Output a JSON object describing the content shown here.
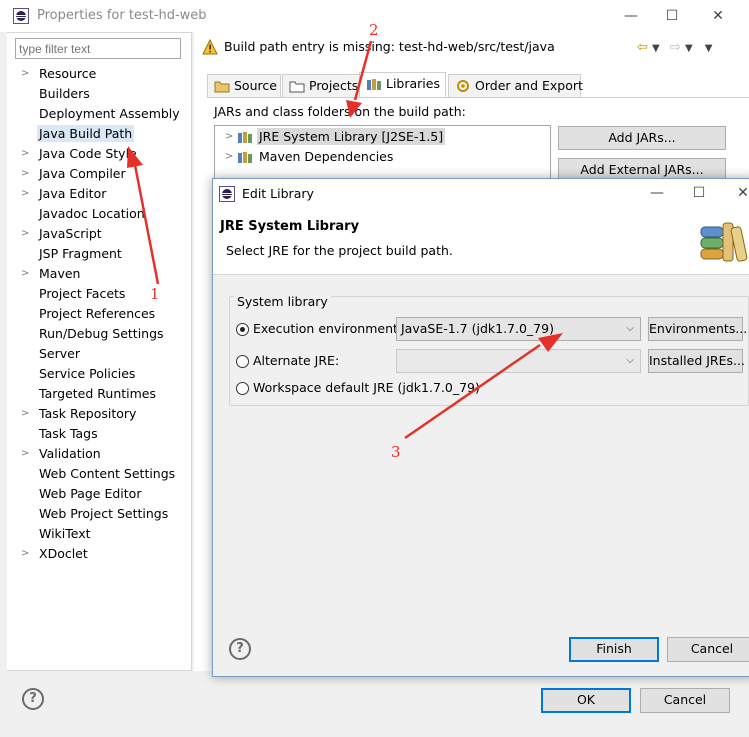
{
  "window": {
    "title": "Properties for test-hd-web",
    "minimize": "—",
    "maximize": "☐",
    "close": "✕"
  },
  "filter": {
    "placeholder": "type filter text"
  },
  "tree": [
    {
      "label": "Resource",
      "expandable": true
    },
    {
      "label": "Builders",
      "expandable": false
    },
    {
      "label": "Deployment Assembly",
      "expandable": false
    },
    {
      "label": "Java Build Path",
      "expandable": false,
      "selected": true
    },
    {
      "label": "Java Code Style",
      "expandable": true
    },
    {
      "label": "Java Compiler",
      "expandable": true
    },
    {
      "label": "Java Editor",
      "expandable": true
    },
    {
      "label": "Javadoc Location",
      "expandable": false
    },
    {
      "label": "JavaScript",
      "expandable": true
    },
    {
      "label": "JSP Fragment",
      "expandable": false
    },
    {
      "label": "Maven",
      "expandable": true
    },
    {
      "label": "Project Facets",
      "expandable": false
    },
    {
      "label": "Project References",
      "expandable": false
    },
    {
      "label": "Run/Debug Settings",
      "expandable": false
    },
    {
      "label": "Server",
      "expandable": false
    },
    {
      "label": "Service Policies",
      "expandable": false
    },
    {
      "label": "Targeted Runtimes",
      "expandable": false
    },
    {
      "label": "Task Repository",
      "expandable": true
    },
    {
      "label": "Task Tags",
      "expandable": false
    },
    {
      "label": "Validation",
      "expandable": true
    },
    {
      "label": "Web Content Settings",
      "expandable": false
    },
    {
      "label": "Web Page Editor",
      "expandable": false
    },
    {
      "label": "Web Project Settings",
      "expandable": false
    },
    {
      "label": "WikiText",
      "expandable": false
    },
    {
      "label": "XDoclet",
      "expandable": true
    }
  ],
  "header": {
    "message": "Build path entry is missing: test-hd-web/src/test/java"
  },
  "tabs": [
    "Source",
    "Projects",
    "Libraries",
    "Order and Export"
  ],
  "libraries": {
    "label": "JARs and class folders on the build path:",
    "items": [
      "JRE System Library [J2SE-1.5]",
      "Maven Dependencies"
    ],
    "add_jars": "Add JARs...",
    "add_external_jars": "Add External JARs..."
  },
  "outer_buttons": {
    "ok": "OK",
    "cancel": "Cancel"
  },
  "dialog": {
    "title": "Edit Library",
    "heading": "JRE System Library",
    "subheading": "Select JRE for the project build path.",
    "group_label": "System library",
    "execution_env_label": "Execution environment:",
    "execution_env_value": "JavaSE-1.7 (jdk1.7.0_79)",
    "environments_button": "Environments...",
    "alternate_jre_label": "Alternate JRE:",
    "alternate_jre_value": "",
    "installed_jres_button": "Installed JREs...",
    "workspace_default_label": "Workspace default JRE (jdk1.7.0_79)",
    "finish": "Finish",
    "cancel": "Cancel",
    "close": "✕",
    "maximize": "☐",
    "minimize": "—"
  },
  "annotations": [
    "1",
    "2",
    "3"
  ],
  "colors": {
    "annotation": "#e4322b",
    "default_button_border": "#0078d7",
    "selection": "#d9e7f7"
  }
}
